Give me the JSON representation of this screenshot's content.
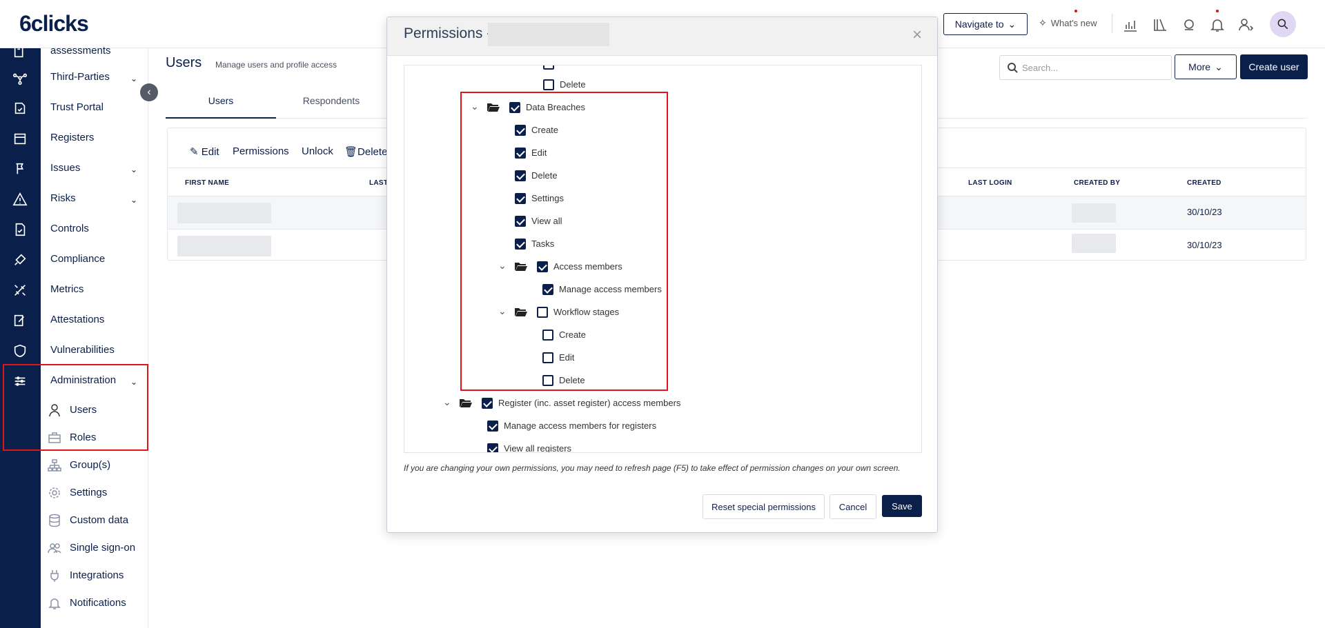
{
  "app": {
    "logo": "6clicks"
  },
  "topbar": {
    "navigate_to": "Navigate to",
    "whats_new": "What's new"
  },
  "sidenav": {
    "items": [
      {
        "label": "assessments"
      },
      {
        "label": "Third-Parties"
      },
      {
        "label": "Trust Portal"
      },
      {
        "label": "Registers"
      },
      {
        "label": "Issues"
      },
      {
        "label": "Risks"
      },
      {
        "label": "Controls"
      },
      {
        "label": "Compliance"
      },
      {
        "label": "Metrics"
      },
      {
        "label": "Attestations"
      },
      {
        "label": "Vulnerabilities"
      },
      {
        "label": "Administration"
      }
    ],
    "subitems": [
      {
        "label": "Users"
      },
      {
        "label": "Roles"
      },
      {
        "label": "Group(s)"
      },
      {
        "label": "Settings"
      },
      {
        "label": "Custom data"
      },
      {
        "label": "Single sign-on"
      },
      {
        "label": "Integrations"
      },
      {
        "label": "Notifications"
      }
    ]
  },
  "page": {
    "title": "Users",
    "subtitle": "Manage users and profile access",
    "tabs": [
      {
        "label": "Users"
      },
      {
        "label": "Respondents"
      }
    ],
    "search_placeholder": "Search...",
    "more_label": "More",
    "create_user_label": "Create user"
  },
  "table": {
    "toolbar": {
      "edit": "Edit",
      "permissions": "Permissions",
      "unlock": "Unlock",
      "delete": "Delete"
    },
    "headers": {
      "first_name": "FIRST NAME",
      "last_name": "LAST",
      "last_login": "LAST LOGIN",
      "created_by": "CREATED BY",
      "created": "CREATED"
    },
    "rows": [
      {
        "created": "30/10/23"
      },
      {
        "created": "30/10/23"
      }
    ]
  },
  "dialog": {
    "title": "Permissions -",
    "close": "×",
    "tree": {
      "top_delete": "Delete",
      "data_breaches": {
        "label": "Data Breaches",
        "checked": true,
        "children": [
          "Create",
          "Edit",
          "Delete",
          "Settings",
          "View all",
          "Tasks"
        ],
        "access_members": {
          "label": "Access members",
          "child": "Manage access members"
        },
        "workflow_stages": {
          "label": "Workflow stages",
          "children": [
            "Create",
            "Edit",
            "Delete"
          ]
        }
      },
      "register": {
        "label": "Register (inc. asset register) access members",
        "children": [
          "Manage access members for registers",
          "View all registers"
        ]
      }
    },
    "note": "If you are changing your own permissions, you may need to refresh page (F5) to take effect of permission changes on your own screen.",
    "buttons": {
      "reset": "Reset special permissions",
      "cancel": "Cancel",
      "save": "Save"
    }
  },
  "colors": {
    "brand": "#0b1f4b",
    "highlight": "#e0121a"
  }
}
